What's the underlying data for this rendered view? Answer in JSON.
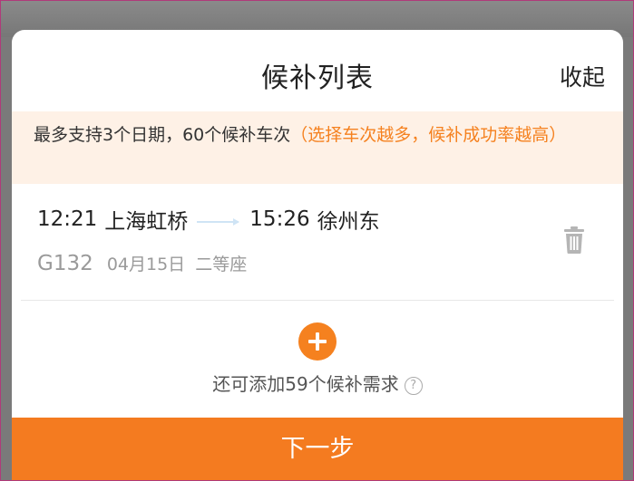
{
  "header": {
    "title": "候补列表",
    "collapse_label": "收起"
  },
  "notice": {
    "text": "最多支持3个日期，60个候补车次",
    "highlight": "（选择车次越多，候补成功率越高）"
  },
  "trains": [
    {
      "depart_time": "12:21",
      "depart_station": "上海虹桥",
      "arrive_time": "15:26",
      "arrive_station": "徐州东",
      "train_no": "G132",
      "date": "04月15日",
      "seat": "二等座"
    }
  ],
  "add": {
    "remaining_text": "还可添加59个候补需求",
    "help_glyph": "?"
  },
  "footer": {
    "next_label": "下一步"
  },
  "colors": {
    "accent": "#f47b20",
    "notice_bg": "#fef1e6",
    "muted": "#9a9a9a"
  },
  "icons": {
    "delete": "trash-icon",
    "add": "plus-icon",
    "help": "question-icon"
  }
}
